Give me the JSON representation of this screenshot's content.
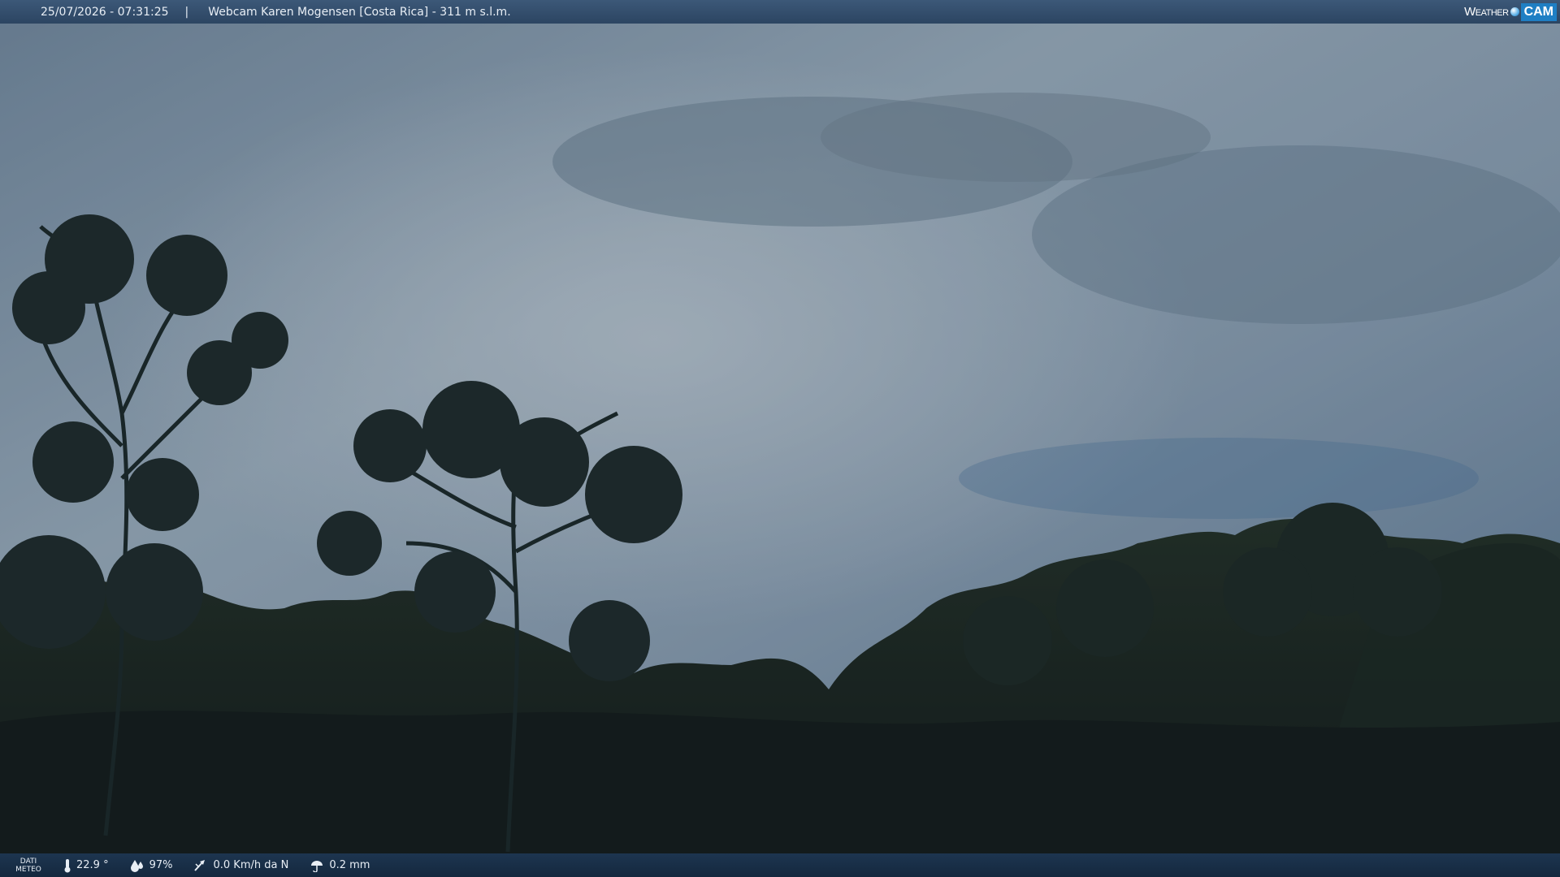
{
  "header": {
    "timestamp": "25/07/2026 - 07:31:25",
    "separator": "|",
    "camera_title": "Webcam Karen Mogensen [Costa Rica]  - 311 m s.l.m.",
    "logo_weather": "Weather",
    "logo_cam": "CAM"
  },
  "footer": {
    "label_line1": "DATI",
    "label_line2": "METEO",
    "temperature": "22.9 °",
    "humidity": "97%",
    "wind": "0.0 Km/h da N",
    "rain": "0.2 mm",
    "icons": [
      "thermometer-icon",
      "humidity-icon",
      "wind-icon",
      "rain-icon"
    ]
  },
  "colors": {
    "topbar": "#2f4a68",
    "bottombar": "#162b42",
    "sky_light": "#a9bccb",
    "sky_dark": "#6d869c",
    "foliage": "#18231f"
  }
}
